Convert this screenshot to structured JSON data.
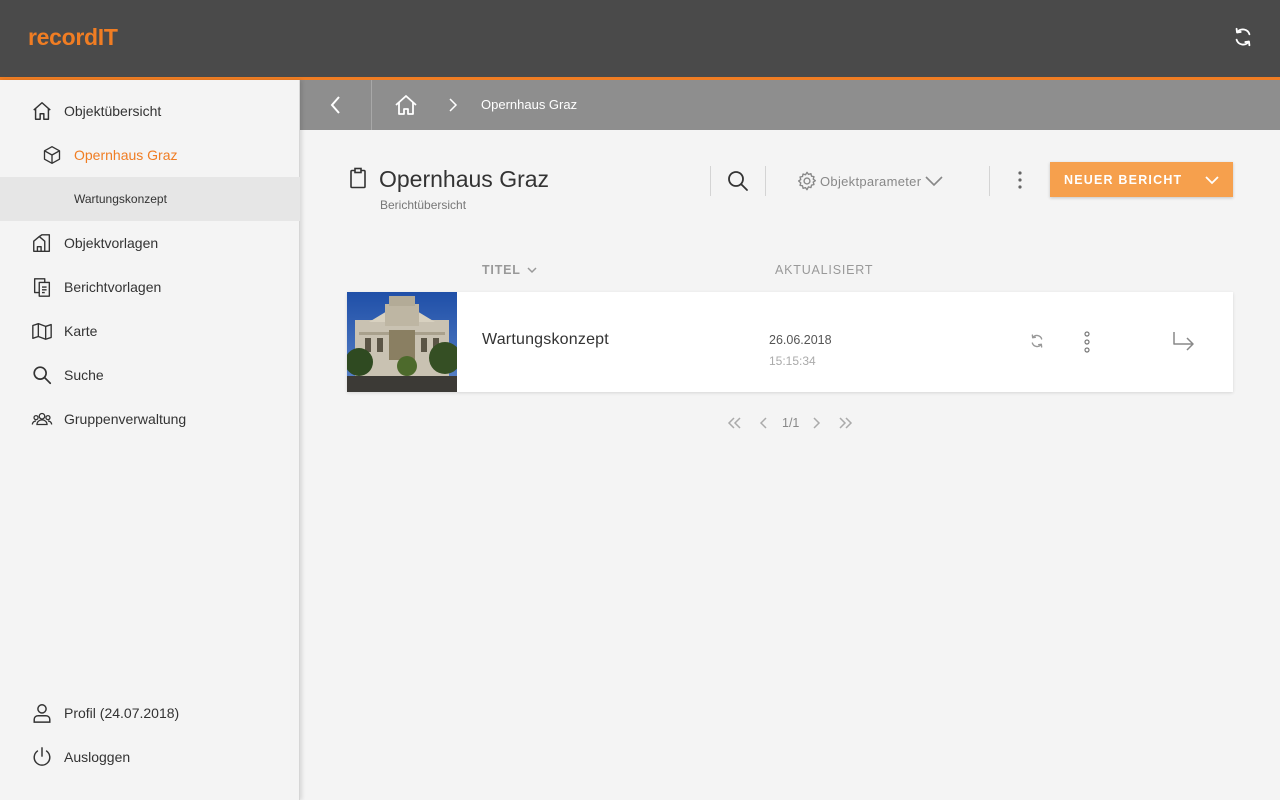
{
  "app": {
    "brand": "recordIT",
    "sync_icon": "sync-icon"
  },
  "colors": {
    "accent": "#f07d23",
    "button": "#f6a04d",
    "topbar": "#4a4a4a",
    "crumbbar": "#8e8e8e"
  },
  "sidebar": {
    "items": [
      {
        "label": "Objektübersicht",
        "icon": "home-icon"
      },
      {
        "label": "Opernhaus Graz",
        "icon": "cube-icon"
      },
      {
        "label": "Wartungskonzept"
      },
      {
        "label": "Objektvorlagen",
        "icon": "building-template-icon"
      },
      {
        "label": "Berichtvorlagen",
        "icon": "report-template-icon"
      },
      {
        "label": "Karte",
        "icon": "map-icon"
      },
      {
        "label": "Suche",
        "icon": "search-icon"
      },
      {
        "label": "Gruppenverwaltung",
        "icon": "group-icon"
      }
    ],
    "footer": [
      {
        "label": "Profil (24.07.2018)",
        "icon": "user-icon"
      },
      {
        "label": "Ausloggen",
        "icon": "power-icon"
      }
    ]
  },
  "breadcrumb": {
    "back_icon": "chevron-left-icon",
    "home_icon": "home-icon",
    "current": "Opernhaus Graz"
  },
  "header": {
    "title": "Opernhaus Graz",
    "subtitle": "Berichtübersicht",
    "params_label": "Objektparameter",
    "new_button_label": "NEUER BERICHT"
  },
  "table": {
    "columns": {
      "title": "TITEL",
      "updated": "AKTUALISIERT"
    },
    "rows": [
      {
        "title": "Wartungskonzept",
        "date": "26.06.2018",
        "time": "15:15:34"
      }
    ]
  },
  "pagination": {
    "text": "1/1"
  }
}
